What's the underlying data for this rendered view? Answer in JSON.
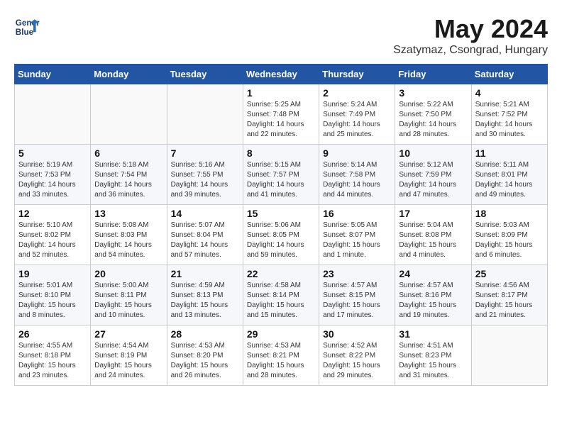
{
  "header": {
    "logo_line1": "General",
    "logo_line2": "Blue",
    "month_year": "May 2024",
    "location": "Szatymaz, Csongrad, Hungary"
  },
  "days_of_week": [
    "Sunday",
    "Monday",
    "Tuesday",
    "Wednesday",
    "Thursday",
    "Friday",
    "Saturday"
  ],
  "weeks": [
    [
      {
        "day": "",
        "sunrise": "",
        "sunset": "",
        "daylight": ""
      },
      {
        "day": "",
        "sunrise": "",
        "sunset": "",
        "daylight": ""
      },
      {
        "day": "",
        "sunrise": "",
        "sunset": "",
        "daylight": ""
      },
      {
        "day": "1",
        "sunrise": "Sunrise: 5:25 AM",
        "sunset": "Sunset: 7:48 PM",
        "daylight": "Daylight: 14 hours and 22 minutes."
      },
      {
        "day": "2",
        "sunrise": "Sunrise: 5:24 AM",
        "sunset": "Sunset: 7:49 PM",
        "daylight": "Daylight: 14 hours and 25 minutes."
      },
      {
        "day": "3",
        "sunrise": "Sunrise: 5:22 AM",
        "sunset": "Sunset: 7:50 PM",
        "daylight": "Daylight: 14 hours and 28 minutes."
      },
      {
        "day": "4",
        "sunrise": "Sunrise: 5:21 AM",
        "sunset": "Sunset: 7:52 PM",
        "daylight": "Daylight: 14 hours and 30 minutes."
      }
    ],
    [
      {
        "day": "5",
        "sunrise": "Sunrise: 5:19 AM",
        "sunset": "Sunset: 7:53 PM",
        "daylight": "Daylight: 14 hours and 33 minutes."
      },
      {
        "day": "6",
        "sunrise": "Sunrise: 5:18 AM",
        "sunset": "Sunset: 7:54 PM",
        "daylight": "Daylight: 14 hours and 36 minutes."
      },
      {
        "day": "7",
        "sunrise": "Sunrise: 5:16 AM",
        "sunset": "Sunset: 7:55 PM",
        "daylight": "Daylight: 14 hours and 39 minutes."
      },
      {
        "day": "8",
        "sunrise": "Sunrise: 5:15 AM",
        "sunset": "Sunset: 7:57 PM",
        "daylight": "Daylight: 14 hours and 41 minutes."
      },
      {
        "day": "9",
        "sunrise": "Sunrise: 5:14 AM",
        "sunset": "Sunset: 7:58 PM",
        "daylight": "Daylight: 14 hours and 44 minutes."
      },
      {
        "day": "10",
        "sunrise": "Sunrise: 5:12 AM",
        "sunset": "Sunset: 7:59 PM",
        "daylight": "Daylight: 14 hours and 47 minutes."
      },
      {
        "day": "11",
        "sunrise": "Sunrise: 5:11 AM",
        "sunset": "Sunset: 8:01 PM",
        "daylight": "Daylight: 14 hours and 49 minutes."
      }
    ],
    [
      {
        "day": "12",
        "sunrise": "Sunrise: 5:10 AM",
        "sunset": "Sunset: 8:02 PM",
        "daylight": "Daylight: 14 hours and 52 minutes."
      },
      {
        "day": "13",
        "sunrise": "Sunrise: 5:08 AM",
        "sunset": "Sunset: 8:03 PM",
        "daylight": "Daylight: 14 hours and 54 minutes."
      },
      {
        "day": "14",
        "sunrise": "Sunrise: 5:07 AM",
        "sunset": "Sunset: 8:04 PM",
        "daylight": "Daylight: 14 hours and 57 minutes."
      },
      {
        "day": "15",
        "sunrise": "Sunrise: 5:06 AM",
        "sunset": "Sunset: 8:05 PM",
        "daylight": "Daylight: 14 hours and 59 minutes."
      },
      {
        "day": "16",
        "sunrise": "Sunrise: 5:05 AM",
        "sunset": "Sunset: 8:07 PM",
        "daylight": "Daylight: 15 hours and 1 minute."
      },
      {
        "day": "17",
        "sunrise": "Sunrise: 5:04 AM",
        "sunset": "Sunset: 8:08 PM",
        "daylight": "Daylight: 15 hours and 4 minutes."
      },
      {
        "day": "18",
        "sunrise": "Sunrise: 5:03 AM",
        "sunset": "Sunset: 8:09 PM",
        "daylight": "Daylight: 15 hours and 6 minutes."
      }
    ],
    [
      {
        "day": "19",
        "sunrise": "Sunrise: 5:01 AM",
        "sunset": "Sunset: 8:10 PM",
        "daylight": "Daylight: 15 hours and 8 minutes."
      },
      {
        "day": "20",
        "sunrise": "Sunrise: 5:00 AM",
        "sunset": "Sunset: 8:11 PM",
        "daylight": "Daylight: 15 hours and 10 minutes."
      },
      {
        "day": "21",
        "sunrise": "Sunrise: 4:59 AM",
        "sunset": "Sunset: 8:13 PM",
        "daylight": "Daylight: 15 hours and 13 minutes."
      },
      {
        "day": "22",
        "sunrise": "Sunrise: 4:58 AM",
        "sunset": "Sunset: 8:14 PM",
        "daylight": "Daylight: 15 hours and 15 minutes."
      },
      {
        "day": "23",
        "sunrise": "Sunrise: 4:57 AM",
        "sunset": "Sunset: 8:15 PM",
        "daylight": "Daylight: 15 hours and 17 minutes."
      },
      {
        "day": "24",
        "sunrise": "Sunrise: 4:57 AM",
        "sunset": "Sunset: 8:16 PM",
        "daylight": "Daylight: 15 hours and 19 minutes."
      },
      {
        "day": "25",
        "sunrise": "Sunrise: 4:56 AM",
        "sunset": "Sunset: 8:17 PM",
        "daylight": "Daylight: 15 hours and 21 minutes."
      }
    ],
    [
      {
        "day": "26",
        "sunrise": "Sunrise: 4:55 AM",
        "sunset": "Sunset: 8:18 PM",
        "daylight": "Daylight: 15 hours and 23 minutes."
      },
      {
        "day": "27",
        "sunrise": "Sunrise: 4:54 AM",
        "sunset": "Sunset: 8:19 PM",
        "daylight": "Daylight: 15 hours and 24 minutes."
      },
      {
        "day": "28",
        "sunrise": "Sunrise: 4:53 AM",
        "sunset": "Sunset: 8:20 PM",
        "daylight": "Daylight: 15 hours and 26 minutes."
      },
      {
        "day": "29",
        "sunrise": "Sunrise: 4:53 AM",
        "sunset": "Sunset: 8:21 PM",
        "daylight": "Daylight: 15 hours and 28 minutes."
      },
      {
        "day": "30",
        "sunrise": "Sunrise: 4:52 AM",
        "sunset": "Sunset: 8:22 PM",
        "daylight": "Daylight: 15 hours and 29 minutes."
      },
      {
        "day": "31",
        "sunrise": "Sunrise: 4:51 AM",
        "sunset": "Sunset: 8:23 PM",
        "daylight": "Daylight: 15 hours and 31 minutes."
      },
      {
        "day": "",
        "sunrise": "",
        "sunset": "",
        "daylight": ""
      }
    ]
  ]
}
